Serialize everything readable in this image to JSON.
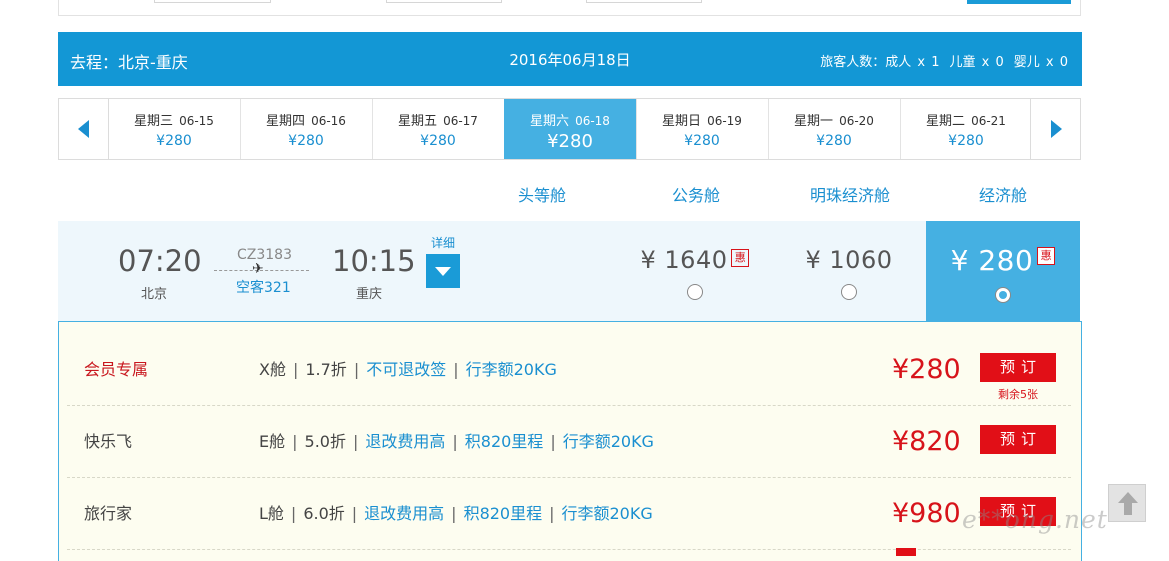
{
  "route": {
    "title": "去程：北京-重庆",
    "date": "2016年06月18日",
    "passengers": {
      "label": "旅客人数：",
      "adult": "成人 x 1",
      "child": "儿童 x 0",
      "infant": "婴儿 x 0"
    }
  },
  "days": [
    {
      "weekday": "星期三",
      "date": "06-15",
      "price": "¥280"
    },
    {
      "weekday": "星期四",
      "date": "06-16",
      "price": "¥280"
    },
    {
      "weekday": "星期五",
      "date": "06-17",
      "price": "¥280"
    },
    {
      "weekday": "星期六",
      "date": "06-18",
      "price": "¥280"
    },
    {
      "weekday": "星期日",
      "date": "06-19",
      "price": "¥280"
    },
    {
      "weekday": "星期一",
      "date": "06-20",
      "price": "¥280"
    },
    {
      "weekday": "星期二",
      "date": "06-21",
      "price": "¥280"
    }
  ],
  "cabins": [
    "头等舱",
    "公务舱",
    "明珠经济舱",
    "经济舱"
  ],
  "flight": {
    "dep_time": "07:20",
    "dep_city": "北京",
    "arr_time": "10:15",
    "arr_city": "重庆",
    "flight_no": "CZ3183",
    "plane_icon": "✈",
    "aircraft": "空客321",
    "detail_label": "详细",
    "prices": [
      {
        "amount": "¥ 1640",
        "badge": "惠"
      },
      {
        "amount": "¥ 1060",
        "badge": ""
      },
      {
        "amount": "¥ 280",
        "badge": "惠"
      }
    ]
  },
  "fares": [
    {
      "name": "会员专属",
      "cabin": "X舱",
      "discount": "1.7折",
      "policy": "不可退改签",
      "mileage": "",
      "baggage": "行李额20KG",
      "price": "¥280",
      "book": "预订",
      "remain": "剩余5张"
    },
    {
      "name": "快乐飞",
      "cabin": "E舱",
      "discount": "5.0折",
      "policy": "退改费用高",
      "mileage": "积820里程",
      "baggage": "行李额20KG",
      "price": "¥820",
      "book": "预订",
      "remain": ""
    },
    {
      "name": "旅行家",
      "cabin": "L舱",
      "discount": "6.0折",
      "policy": "退改费用高",
      "mileage": "积820里程",
      "baggage": "行李额20KG",
      "price": "¥980",
      "book": "预订",
      "remain": ""
    }
  ],
  "watermark": "e**ong.net",
  "colors": {
    "brand_blue": "#1397d5",
    "active_blue": "#45b0e2",
    "price_red": "#d7131a",
    "book_red": "#e10f17"
  }
}
